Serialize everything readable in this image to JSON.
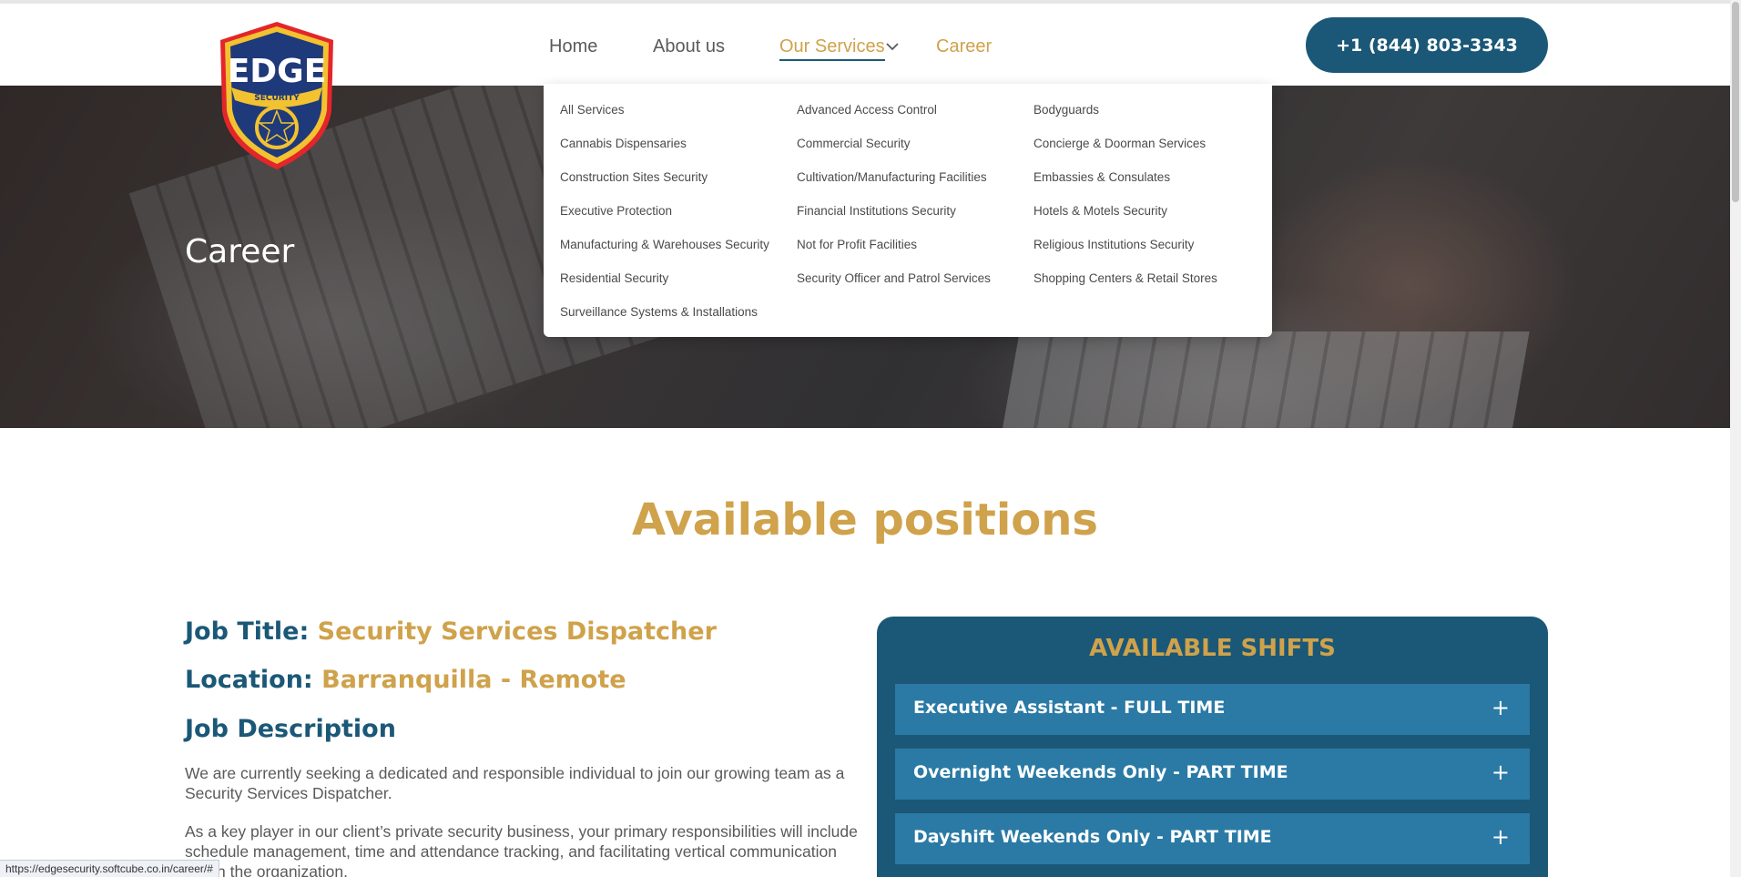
{
  "header": {
    "logo_text": "EDGE",
    "logo_subtext": "SECURITY",
    "nav": {
      "home": "Home",
      "about": "About us",
      "services": "Our Services",
      "career": "Career"
    },
    "phone": "+1 (844) 803-3343"
  },
  "services_menu": {
    "col1": [
      "All Services",
      "Cannabis Dispensaries",
      "Construction Sites Security",
      "Executive Protection",
      "Manufacturing & Warehouses Security",
      "Residential Security",
      "Surveillance Systems & Installations"
    ],
    "col2": [
      "Advanced Access Control",
      "Commercial Security",
      "Cultivation/Manufacturing Facilities",
      "Financial Institutions Security",
      "Not for Profit Facilities",
      "Security Officer and Patrol Services"
    ],
    "col3": [
      "Bodyguards",
      "Concierge & Doorman Services",
      "Embassies & Consulates",
      "Hotels & Motels Security",
      "Religious Institutions Security",
      "Shopping Centers & Retail Stores"
    ]
  },
  "hero": {
    "title": "Career"
  },
  "main": {
    "section_title": "Available positions",
    "job": {
      "title_label": "Job Title:",
      "title_value": "Security Services Dispatcher",
      "location_label": "Location:",
      "location_value": "Barranquilla - Remote",
      "description_heading": "Job Description",
      "paragraph1": "We are currently seeking a dedicated and responsible individual to join our growing team as a Security Services Dispatcher.",
      "paragraph2": "As a key player in our client’s private security business, your primary responsibilities will include schedule management, time and attendance tracking, and facilitating vertical communication within the organization."
    },
    "shifts": {
      "title": "AVAILABLE SHIFTS",
      "items": [
        "Executive Assistant - FULL TIME",
        "Overnight Weekends Only - PART TIME",
        "Dayshift Weekends Only - PART TIME"
      ],
      "expand_symbol": "+"
    }
  },
  "status_bar": {
    "url": "https://edgesecurity.softcube.co.in/career/#"
  },
  "colors": {
    "brand_navy": "#1b5877",
    "brand_gold": "#cfa24b",
    "shift_blue": "#2a7aa5"
  },
  "icons": {
    "logo": "edge-security-shield-logo",
    "chevron": "chevron-down-icon",
    "plus": "plus-icon"
  }
}
